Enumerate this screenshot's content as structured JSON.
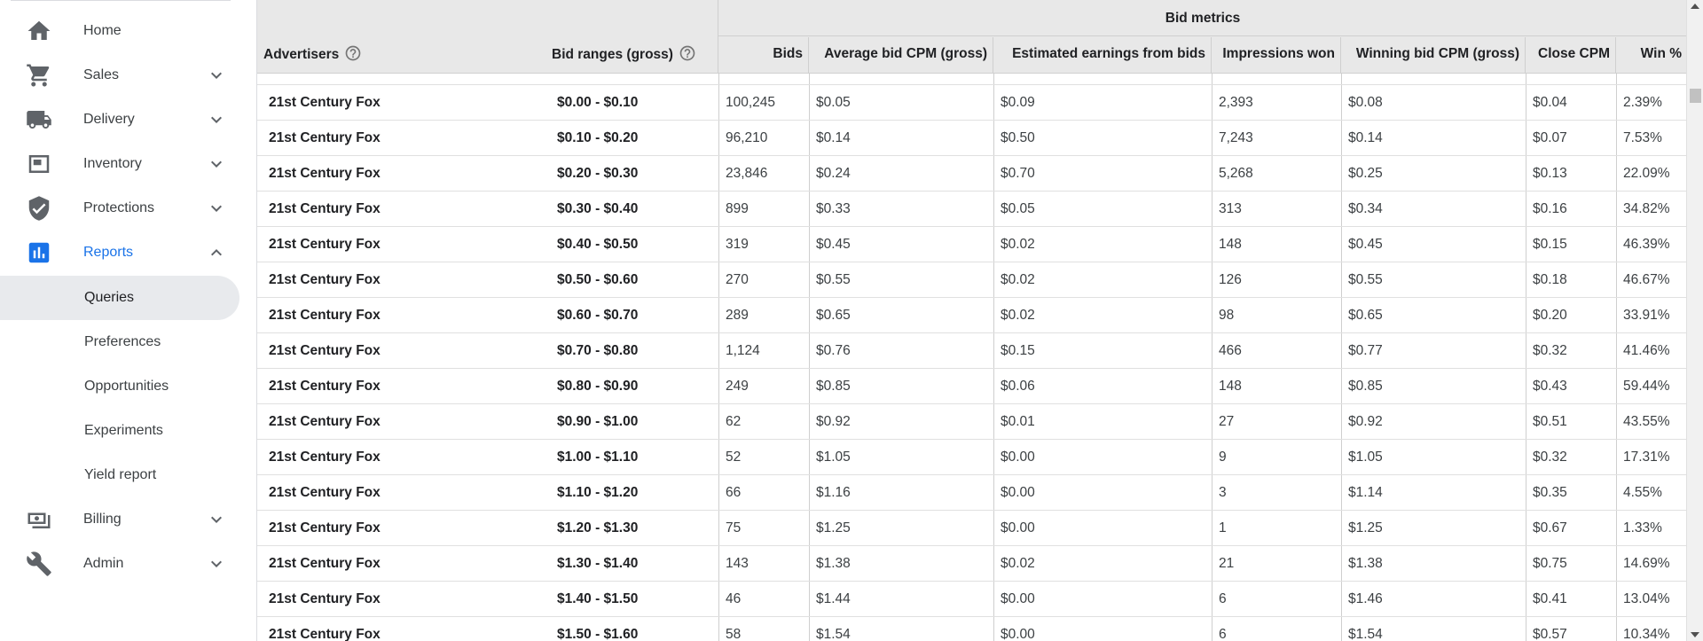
{
  "sidebar": {
    "items": [
      {
        "label": "Home",
        "icon": "home-icon",
        "has_chevron": false
      },
      {
        "label": "Sales",
        "icon": "cart-icon",
        "has_chevron": true
      },
      {
        "label": "Delivery",
        "icon": "truck-icon",
        "has_chevron": true
      },
      {
        "label": "Inventory",
        "icon": "inventory-icon",
        "has_chevron": true
      },
      {
        "label": "Protections",
        "icon": "shield-icon",
        "has_chevron": true
      },
      {
        "label": "Reports",
        "icon": "bar-chart-icon",
        "has_chevron": true,
        "expanded": true
      },
      {
        "label": "Billing",
        "icon": "money-icon",
        "has_chevron": true
      },
      {
        "label": "Admin",
        "icon": "wrench-icon",
        "has_chevron": true
      }
    ],
    "report_subitems": [
      {
        "label": "Queries",
        "selected": true
      },
      {
        "label": "Preferences"
      },
      {
        "label": "Opportunities"
      },
      {
        "label": "Experiments"
      },
      {
        "label": "Yield report"
      }
    ]
  },
  "table": {
    "col_advertisers": "Advertisers",
    "col_bid_ranges": "Bid ranges (gross)",
    "group_title": "Bid metrics",
    "metric_headers": [
      "Bids",
      "Average bid CPM (gross)",
      "Estimated earnings from bids",
      "Impressions won",
      "Winning bid CPM (gross)",
      "Close CPM",
      "Win %"
    ],
    "rows": [
      {
        "advertiser": "21st Century Fox",
        "range": "$0.00 - $0.10",
        "metrics": [
          "100,245",
          "$0.05",
          "$0.09",
          "2,393",
          "$0.08",
          "$0.04",
          "2.39%"
        ]
      },
      {
        "advertiser": "21st Century Fox",
        "range": "$0.10 - $0.20",
        "metrics": [
          "96,210",
          "$0.14",
          "$0.50",
          "7,243",
          "$0.14",
          "$0.07",
          "7.53%"
        ]
      },
      {
        "advertiser": "21st Century Fox",
        "range": "$0.20 - $0.30",
        "metrics": [
          "23,846",
          "$0.24",
          "$0.70",
          "5,268",
          "$0.25",
          "$0.13",
          "22.09%"
        ]
      },
      {
        "advertiser": "21st Century Fox",
        "range": "$0.30 - $0.40",
        "metrics": [
          "899",
          "$0.33",
          "$0.05",
          "313",
          "$0.34",
          "$0.16",
          "34.82%"
        ]
      },
      {
        "advertiser": "21st Century Fox",
        "range": "$0.40 - $0.50",
        "metrics": [
          "319",
          "$0.45",
          "$0.02",
          "148",
          "$0.45",
          "$0.15",
          "46.39%"
        ]
      },
      {
        "advertiser": "21st Century Fox",
        "range": "$0.50 - $0.60",
        "metrics": [
          "270",
          "$0.55",
          "$0.02",
          "126",
          "$0.55",
          "$0.18",
          "46.67%"
        ]
      },
      {
        "advertiser": "21st Century Fox",
        "range": "$0.60 - $0.70",
        "metrics": [
          "289",
          "$0.65",
          "$0.02",
          "98",
          "$0.65",
          "$0.20",
          "33.91%"
        ]
      },
      {
        "advertiser": "21st Century Fox",
        "range": "$0.70 - $0.80",
        "metrics": [
          "1,124",
          "$0.76",
          "$0.15",
          "466",
          "$0.77",
          "$0.32",
          "41.46%"
        ]
      },
      {
        "advertiser": "21st Century Fox",
        "range": "$0.80 - $0.90",
        "metrics": [
          "249",
          "$0.85",
          "$0.06",
          "148",
          "$0.85",
          "$0.43",
          "59.44%"
        ]
      },
      {
        "advertiser": "21st Century Fox",
        "range": "$0.90 - $1.00",
        "metrics": [
          "62",
          "$0.92",
          "$0.01",
          "27",
          "$0.92",
          "$0.51",
          "43.55%"
        ]
      },
      {
        "advertiser": "21st Century Fox",
        "range": "$1.00 - $1.10",
        "metrics": [
          "52",
          "$1.05",
          "$0.00",
          "9",
          "$1.05",
          "$0.32",
          "17.31%"
        ]
      },
      {
        "advertiser": "21st Century Fox",
        "range": "$1.10 - $1.20",
        "metrics": [
          "66",
          "$1.16",
          "$0.00",
          "3",
          "$1.14",
          "$0.35",
          "4.55%"
        ]
      },
      {
        "advertiser": "21st Century Fox",
        "range": "$1.20 - $1.30",
        "metrics": [
          "75",
          "$1.25",
          "$0.00",
          "1",
          "$1.25",
          "$0.67",
          "1.33%"
        ]
      },
      {
        "advertiser": "21st Century Fox",
        "range": "$1.30 - $1.40",
        "metrics": [
          "143",
          "$1.38",
          "$0.02",
          "21",
          "$1.38",
          "$0.75",
          "14.69%"
        ]
      },
      {
        "advertiser": "21st Century Fox",
        "range": "$1.40 - $1.50",
        "metrics": [
          "46",
          "$1.44",
          "$0.00",
          "6",
          "$1.46",
          "$0.41",
          "13.04%"
        ]
      },
      {
        "advertiser": "21st Century Fox",
        "range": "$1.50 - $1.60",
        "metrics": [
          "58",
          "$1.54",
          "$0.00",
          "6",
          "$1.54",
          "$0.57",
          "10.34%"
        ]
      }
    ]
  },
  "colors": {
    "accent": "#1a73e8",
    "header_bg": "#e8e8e8",
    "selected_bg": "#e8eaed"
  }
}
